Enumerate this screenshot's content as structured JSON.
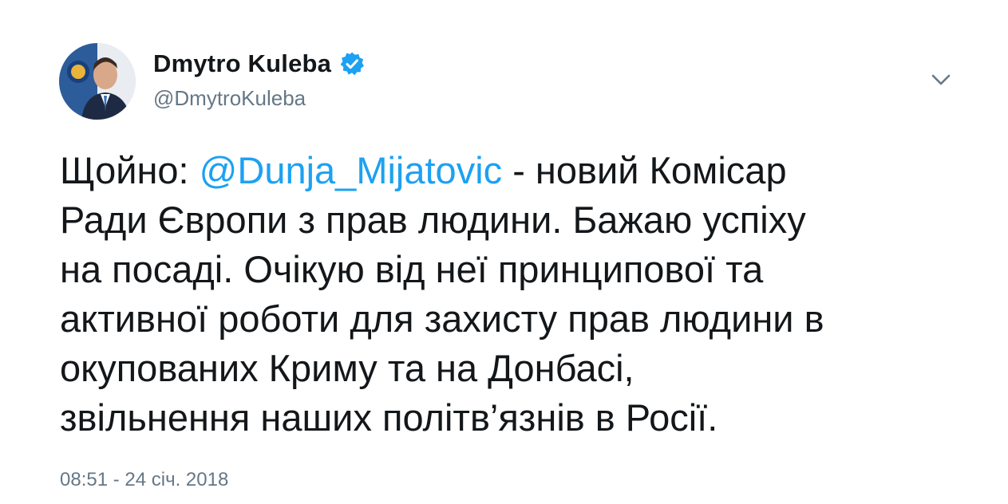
{
  "author": {
    "display_name": "Dmytro Kuleba",
    "handle": "@DmytroKuleba",
    "verified": true,
    "avatar_icon": "profile-photo-avatar",
    "verified_icon": "verified-badge-icon"
  },
  "menu": {
    "caret_icon": "chevron-down-icon"
  },
  "tweet": {
    "text_before": "Щойно: ",
    "mention": "@Dunja_Mijatovic",
    "text_after": " - новий Комісар\nРади Європи з прав людини. Бажаю успіху\nна посаді. Очікую від неї принципової та\nактивної роботи для захисту прав людини в\nокупованих Криму та на Донбасі,\nзвільнення наших політв’язнів в Росії."
  },
  "timestamp": "08:51 - 24 січ. 2018",
  "colors": {
    "accent": "#1da1f2",
    "text_primary": "#14171a",
    "text_secondary": "#657786"
  }
}
